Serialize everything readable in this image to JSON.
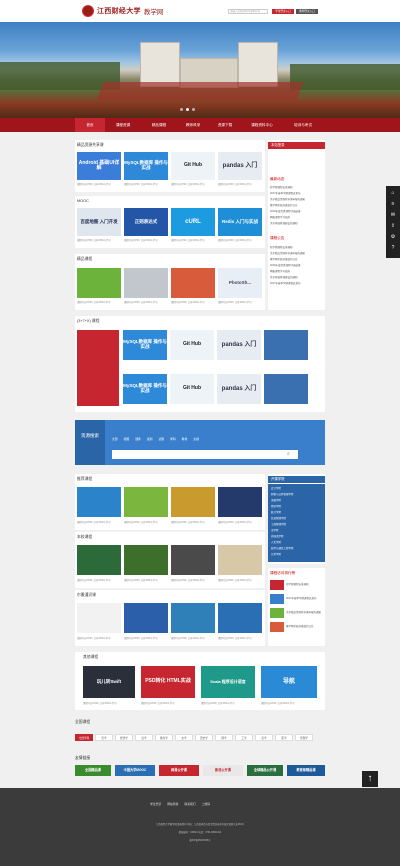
{
  "header": {
    "logo_text": "江西财经大学",
    "logo_sub": "教学网",
    "search_placeholder": "请输入您要搜索的课程名称",
    "login_label": "学生登录入口",
    "teacher_label": "教师登录入口"
  },
  "nav": {
    "items": [
      "首页",
      "课程资源",
      "精品课程",
      "教师风采",
      "资源下载",
      "课程资料中心",
      "培训与考试"
    ]
  },
  "sections": {
    "featured": "精品资源共享课",
    "mooc": "MOOC",
    "quality": "精品课程",
    "three_seven": "(3+7+X) 课程",
    "recommend": "推荐课程",
    "school": "本校课程",
    "general": "尔雅通识课",
    "other": "其他课程",
    "all_courses": "全国课程",
    "friend_links": "友情链接",
    "more": "更多 >"
  },
  "tiles": {
    "android": "Android 基础UI详解",
    "mysql": "MySQL数据库 操作与实战",
    "github": "Git Hub",
    "pandas": "pandas 入门",
    "baidu_map": "百度地图 入门开发",
    "zhengze": "正则表达式",
    "curl": "cURL",
    "redis": "Redis 入门与实战",
    "ps": "PhotoSh..."
  },
  "caption": "课程时长03:56 | 已有1536人学习",
  "sidebar": {
    "notice_title": "课程公告",
    "latest_title": "最新动态",
    "login_title": "本站登录",
    "lines": [
      "新学期课程安排通知",
      "2017年春季学期课程表发布",
      "关于精品资源共享课申报的通知",
      "教学网系统升级维护公告",
      "2016年度优秀课程评选结果",
      "网络课程学习指南",
      "关于开展慕课建设的通知"
    ],
    "open_title": "开课学院",
    "open_items": [
      "会计学院",
      "财税与公共管理学院",
      "金融学院",
      "经济学院",
      "统计学院",
      "信息管理学院",
      "工商管理学院",
      "法学院",
      "外国语学院",
      "人文学院",
      "软件与通信工程学院",
      "艺术学院"
    ],
    "rank_title": "课程访问排行榜"
  },
  "band": {
    "title": "资源搜索",
    "placeholder": "",
    "links": [
      "全部",
      "视频",
      "课件",
      "案例",
      "试题",
      "学科",
      "教材",
      "文献"
    ]
  },
  "tags": [
    "全部学科",
    "哲学",
    "经济学",
    "法学",
    "教育学",
    "文学",
    "历史学",
    "理学",
    "工学",
    "农学",
    "医学",
    "管理学",
    "艺术学"
  ],
  "friend_links": [
    "全国精品课",
    "中国大学MOOC",
    "网易公开课",
    "新浪公开课",
    "全球精品公开课",
    "教育部精品课"
  ],
  "other_tiles": {
    "swift": "玩儿转Swift",
    "psd": "PSD转化 HTML实战",
    "scala": "Scala 程序设计语言",
    "nav": "导航"
  },
  "footer": {
    "links": [
      "学生登录",
      "网站导航",
      "联系我们",
      "二维码"
    ],
    "line1": "江西财经大学教学网 版权所有 地址：江西省南昌市昌北经济技术开发区双港大道169号",
    "line2": "邮政编码：330013 电话：0791-83816114",
    "line3": "赣ICP备05003655号"
  },
  "colors": {
    "brand_red": "#a0141b",
    "active_red": "#c6262f",
    "band_blue": "#3a7fcc",
    "footer": "#3b3b3b"
  }
}
